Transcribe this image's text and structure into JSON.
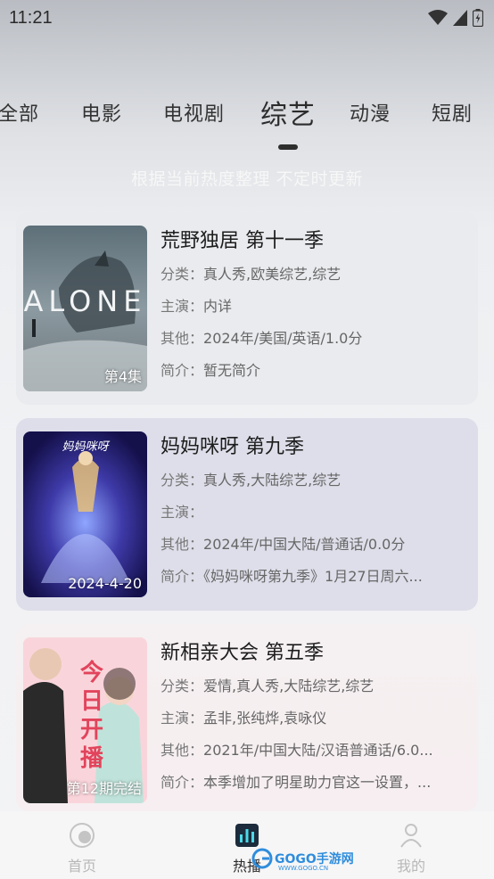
{
  "status_bar": {
    "time": "11:21"
  },
  "tabs": [
    {
      "label": "全部",
      "active": false
    },
    {
      "label": "电影",
      "active": false
    },
    {
      "label": "电视剧",
      "active": false
    },
    {
      "label": "综艺",
      "active": true
    },
    {
      "label": "动漫",
      "active": false
    },
    {
      "label": "短剧",
      "active": false
    }
  ],
  "subtitle": "根据当前热度整理 不定时更新",
  "labels": {
    "category": "分类：",
    "cast": "主演：",
    "other": "其他：",
    "intro": "简介："
  },
  "shows": [
    {
      "title": "荒野独居 第十一季",
      "category": "真人秀,欧美综艺,综艺",
      "cast": "内详",
      "other": "2024年/美国/英语/1.0分",
      "intro": "暂无简介",
      "badge": "第4集",
      "poster_text": "ALONE"
    },
    {
      "title": "妈妈咪呀 第九季",
      "category": "真人秀,大陆综艺,综艺",
      "cast": "",
      "other": "2024年/中国大陆/普通话/0.0分",
      "intro": "《妈妈咪呀第九季》1月27日周六...",
      "badge": "2024-4-20",
      "poster_text": "妈妈咪呀"
    },
    {
      "title": "新相亲大会 第五季",
      "category": "爱情,真人秀,大陆综艺,综艺",
      "cast": "孟非,张纯烨,袁咏仪",
      "other": "2021年/中国大陆/汉语普通话/6.0...",
      "intro": "本季增加了明星助力官这一设置，...",
      "badge": "第12期完结",
      "poster_text": "今日开播"
    }
  ],
  "bottom_nav": [
    {
      "label": "首页",
      "icon": "home-icon",
      "active": false
    },
    {
      "label": "热播",
      "icon": "hot-chart-icon",
      "active": true
    },
    {
      "label": "我的",
      "icon": "profile-icon",
      "active": false
    }
  ],
  "watermark": {
    "text": "GOGO手游网",
    "url": "WWW.GOGO.CN"
  },
  "colors": {
    "accent": "#2e2e2e",
    "inactive_nav": "#b8b8b8",
    "watermark": "#2f8ddc"
  }
}
